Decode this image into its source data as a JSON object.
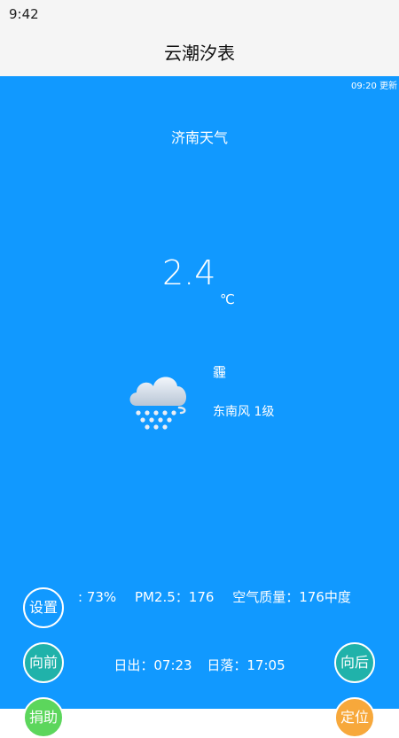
{
  "status": {
    "time": "9:42"
  },
  "app": {
    "title": "云潮汐表"
  },
  "weather": {
    "update_time": "09:20 更新",
    "city": "济南天气",
    "temperature": "2.4",
    "temperature_unit": "℃",
    "condition": "霾",
    "wind": "东南风 1级",
    "icon": "cloud-snow-icon",
    "humidity": ": 73%",
    "pm25": "PM2.5：176",
    "air_quality": "空气质量：176中度",
    "sunrise": "日出：07:23",
    "sunset": "日落：17:05"
  },
  "buttons": {
    "settings": "设置",
    "prev": "向前",
    "next": "向后",
    "donate": "捐助",
    "locate": "定位"
  },
  "colors": {
    "panel": "#1199ff",
    "teal": "#20b2aa",
    "green": "#5cd65c",
    "orange": "#f7a83b"
  }
}
